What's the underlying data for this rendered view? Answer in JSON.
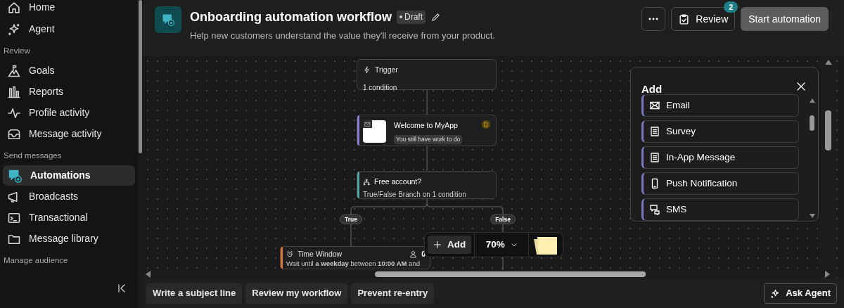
{
  "sidebar": {
    "top_items": [
      {
        "label": "Home",
        "selected": false
      },
      {
        "label": "Agent",
        "selected": false
      }
    ],
    "sections": [
      {
        "title": "Review",
        "items": [
          {
            "label": "Goals",
            "selected": false
          },
          {
            "label": "Reports",
            "selected": false
          },
          {
            "label": "Profile activity",
            "selected": false
          },
          {
            "label": "Message activity",
            "selected": false
          }
        ]
      },
      {
        "title": "Send messages",
        "items": [
          {
            "label": "Automations",
            "selected": true
          },
          {
            "label": "Broadcasts",
            "selected": false
          },
          {
            "label": "Transactional",
            "selected": false
          },
          {
            "label": "Message library",
            "selected": false
          }
        ]
      },
      {
        "title": "Manage audience"
      }
    ]
  },
  "header": {
    "title": "Onboarding automation workflow",
    "status": "Draft",
    "description": "Help new customers understand the value they'll receive from your product.",
    "review_button": "Review",
    "review_count": "2",
    "start_button": "Start automation"
  },
  "canvas": {
    "nodes": [
      {
        "kind": "trigger",
        "title": "Trigger",
        "subtitle": "1 condition"
      },
      {
        "kind": "message",
        "title": "Welcome to MyApp",
        "tag": "You still have work to do",
        "color": "#8b7fd6"
      },
      {
        "kind": "branch",
        "title": "Free account?",
        "subtitle": "True/False Branch on 1 condition",
        "color": "#4fa6a0"
      },
      {
        "kind": "time_window",
        "title": "Time Window",
        "count": "0",
        "text": "Wait until **a weekday** between **10:00 AM** and",
        "color": "#d9783a"
      }
    ],
    "branch_labels": [
      "True",
      "False"
    ],
    "toolbar": {
      "add_label": "Add",
      "zoom": "70%"
    }
  },
  "add_panel": {
    "title": "Add",
    "items": [
      {
        "label": "Email"
      },
      {
        "label": "Survey"
      },
      {
        "label": "In-App Message"
      },
      {
        "label": "Push Notification"
      },
      {
        "label": "SMS"
      }
    ]
  },
  "suggestions": [
    "Write a subject line",
    "Review my workflow",
    "Prevent re-entry"
  ],
  "ask_agent": "Ask Agent"
}
